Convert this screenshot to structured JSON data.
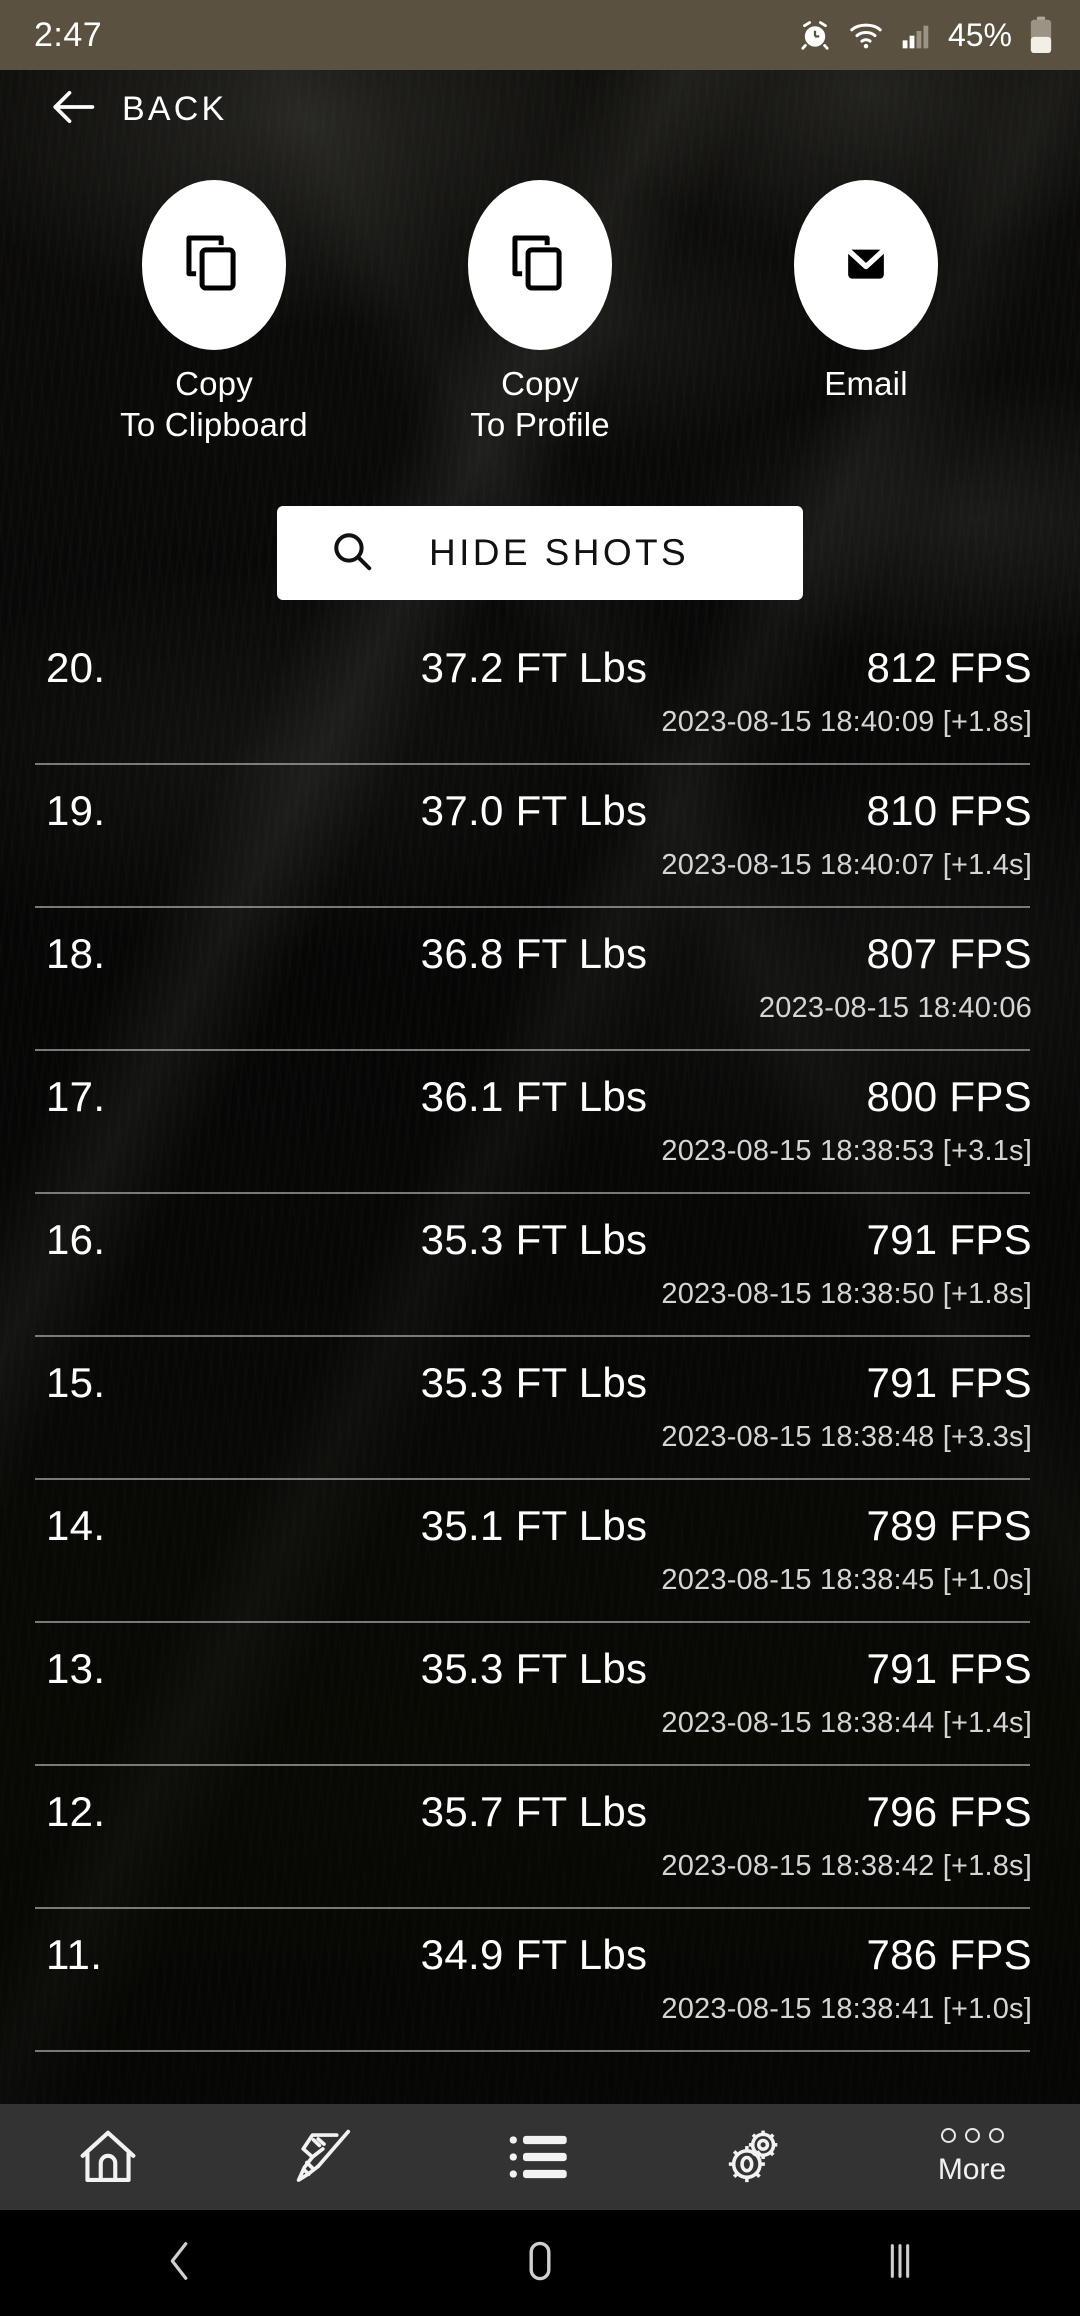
{
  "status_bar": {
    "clock": "2:47",
    "battery_percent": "45%",
    "icons": [
      "alarm-icon",
      "wifi-icon",
      "signal-icon",
      "battery-icon"
    ]
  },
  "header": {
    "back_label": "BACK",
    "back_icon": "arrow-left-icon"
  },
  "actions": [
    {
      "icon": "copy-icon",
      "line1": "Copy",
      "line2": "To Clipboard"
    },
    {
      "icon": "copy-icon",
      "line1": "Copy",
      "line2": "To Profile"
    },
    {
      "icon": "envelope-icon",
      "line1": "Email",
      "line2": ""
    }
  ],
  "toggle_button": {
    "label": "HIDE SHOTS",
    "icon": "search-icon"
  },
  "shots": [
    {
      "index": "20.",
      "energy": "37.2 FT Lbs",
      "speed": "812 FPS",
      "time": "2023-08-15 18:40:09 [+1.8s]"
    },
    {
      "index": "19.",
      "energy": "37.0 FT Lbs",
      "speed": "810 FPS",
      "time": "2023-08-15 18:40:07 [+1.4s]"
    },
    {
      "index": "18.",
      "energy": "36.8 FT Lbs",
      "speed": "807 FPS",
      "time": "2023-08-15 18:40:06"
    },
    {
      "index": "17.",
      "energy": "36.1 FT Lbs",
      "speed": "800 FPS",
      "time": "2023-08-15 18:38:53 [+3.1s]"
    },
    {
      "index": "16.",
      "energy": "35.3 FT Lbs",
      "speed": "791 FPS",
      "time": "2023-08-15 18:38:50 [+1.8s]"
    },
    {
      "index": "15.",
      "energy": "35.3 FT Lbs",
      "speed": "791 FPS",
      "time": "2023-08-15 18:38:48 [+3.3s]"
    },
    {
      "index": "14.",
      "energy": "35.1 FT Lbs",
      "speed": "789 FPS",
      "time": "2023-08-15 18:38:45 [+1.0s]"
    },
    {
      "index": "13.",
      "energy": "35.3 FT Lbs",
      "speed": "791 FPS",
      "time": "2023-08-15 18:38:44 [+1.4s]"
    },
    {
      "index": "12.",
      "energy": "35.7 FT Lbs",
      "speed": "796 FPS",
      "time": "2023-08-15 18:38:42 [+1.8s]"
    },
    {
      "index": "11.",
      "energy": "34.9 FT Lbs",
      "speed": "786 FPS",
      "time": "2023-08-15 18:38:41 [+1.0s]"
    }
  ],
  "tabbar": {
    "items": [
      {
        "icon": "home-icon",
        "label": ""
      },
      {
        "icon": "rifle-icon",
        "label": ""
      },
      {
        "icon": "list-icon",
        "label": ""
      },
      {
        "icon": "gears-icon",
        "label": ""
      },
      {
        "icon": "more-dots-icon",
        "label": "More"
      }
    ]
  },
  "android_nav": {
    "back": "nav-back-icon",
    "home": "nav-home-icon",
    "recents": "nav-recents-icon"
  },
  "colors": {
    "status_bar_bg": "#5b5140",
    "tabbar_bg": "#333333",
    "accent_white": "#ffffff",
    "divider": "#bebebe"
  }
}
